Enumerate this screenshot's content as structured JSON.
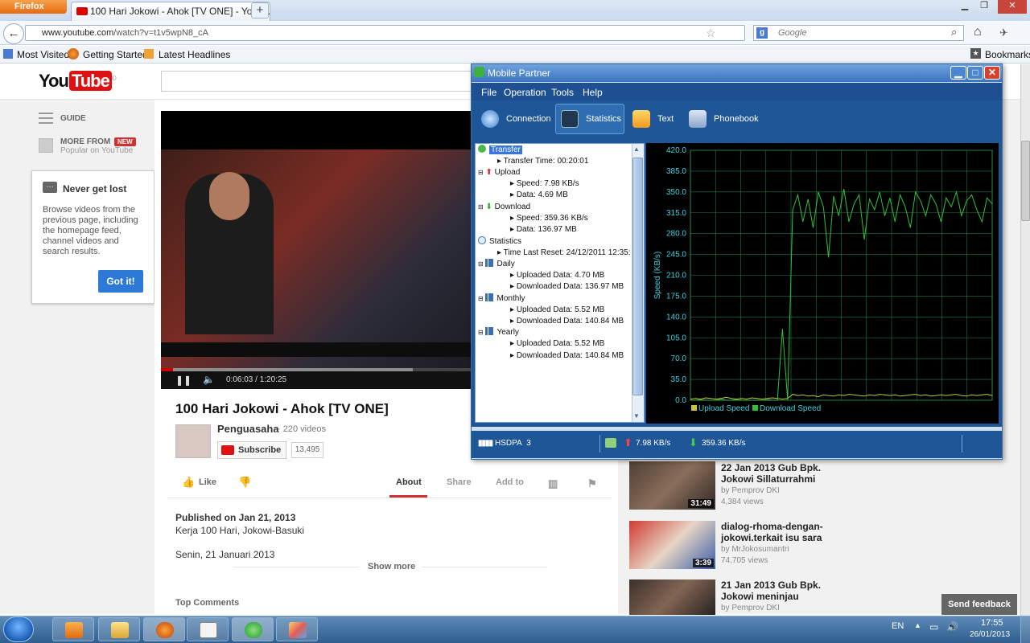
{
  "browser": {
    "menu_button": "Firefox",
    "tab_title": "100 Hari Jokowi - Ahok [TV ONE] - YouT...",
    "tab_close": "✕",
    "new_tab": "+",
    "url_host": "www.youtube.com",
    "url_path": "/watch?v=t1v5wpN8_cA",
    "search_placeholder": "Google",
    "bookmarks": [
      "Most Visited",
      "Getting Started",
      "Latest Headlines"
    ],
    "bookmarks_menu": "Bookmarks"
  },
  "youtube": {
    "logo_you": "You",
    "logo_tube": "Tube",
    "logo_suffix": "ID",
    "guide": "GUIDE",
    "more_from": "MORE FROM",
    "new_badge": "NEW",
    "popular": "Popular on YouTube",
    "popup_title": "Never get lost",
    "popup_text": "Browse videos from the previous page, including the homepage feed, channel videos and search results.",
    "popup_button": "Got it!",
    "video_time": "0:06:03",
    "video_duration": "1:20:25",
    "progress_played_pct": 4,
    "progress_buffered_pct": 81,
    "video_title": "100 Hari Jokowi - Ahok [TV ONE]",
    "channel": "Penguasaha",
    "channel_videos": "220 videos",
    "subscribe": "Subscribe",
    "subscriber_count": "13,495",
    "like": "Like",
    "tabs": [
      "About",
      "Share",
      "Add to"
    ],
    "published": "Published on Jan 21, 2013",
    "desc_line1": "Kerja 100 Hari, Jokowi-Basuki",
    "desc_line2": "Senin, 21 Januari 2013",
    "show_more": "Show more",
    "top_comments": "Top Comments",
    "suggestions": [
      {
        "title": "22 Jan 2013 Gub Bpk. Jokowi Sillaturrahmi",
        "by": "by Pemprov DKI",
        "views": "4,384 views",
        "duration": "31:49"
      },
      {
        "title": "dialog-rhoma-dengan-jokowi.terkait isu sara",
        "by": "by MrJokosumantri",
        "views": "74,705 views",
        "duration": "3:39"
      },
      {
        "title": "21 Jan 2013 Gub Bpk. Jokowi meninjau",
        "by": "by Pemprov DKI",
        "views": "",
        "duration": ""
      }
    ],
    "feedback": "Send feedback"
  },
  "mobile_partner": {
    "title": "Mobile Partner",
    "menu": [
      "File",
      "Operation",
      "Tools",
      "Help"
    ],
    "toolbar": [
      "Connection",
      "Statistics",
      "Text",
      "Phonebook"
    ],
    "tree": {
      "transfer": "Transfer",
      "transfer_time": "Transfer Time: 00:20:01",
      "upload": "Upload",
      "up_speed": "Speed: 7.98 KB/s",
      "up_data": "Data: 4.69 MB",
      "download": "Download",
      "down_speed": "Speed: 359.36 KB/s",
      "down_data": "Data: 136.97 MB",
      "statistics": "Statistics",
      "time_last_reset": "Time Last Reset: 24/12/2011 12:35:",
      "daily": "Daily",
      "daily_up": "Uploaded Data: 4.70 MB",
      "daily_down": "Downloaded Data: 136.97 MB",
      "monthly": "Monthly",
      "monthly_up": "Uploaded Data: 5.52 MB",
      "monthly_down": "Downloaded Data: 140.84 MB",
      "yearly": "Yearly",
      "yearly_up": "Uploaded Data: 5.52 MB",
      "yearly_down": "Downloaded Data: 140.84 MB"
    },
    "status": {
      "network": "HSDPA",
      "signal": "3",
      "up_speed": "7.98 KB/s",
      "down_speed": "359.36 KB/s"
    }
  },
  "chart_data": {
    "type": "line",
    "ylabel": "Speed (KB/s)",
    "ylim": [
      0,
      420
    ],
    "yticks": [
      "420.0",
      "385.0",
      "350.0",
      "315.0",
      "280.0",
      "245.0",
      "210.0",
      "175.0",
      "140.0",
      "105.0",
      "70.0",
      "35.0",
      "0.0"
    ],
    "legend": [
      "Upload Speed",
      "Download Speed"
    ],
    "colors": {
      "upload": "#c9c63a",
      "download": "#2fc23a",
      "grid": "#1f7a4a"
    },
    "series": [
      {
        "name": "Upload Speed",
        "values": [
          2,
          3,
          2,
          4,
          3,
          2,
          3,
          5,
          3,
          2,
          3,
          2,
          4,
          3,
          2,
          3,
          4,
          3,
          2,
          3,
          10,
          8,
          9,
          7,
          8,
          6,
          9,
          8,
          7,
          9,
          8,
          10,
          9,
          8,
          7,
          9,
          8,
          10,
          9,
          8,
          9,
          7,
          8,
          9,
          10,
          8,
          9,
          7,
          8,
          9,
          8,
          9,
          10,
          8,
          7,
          9,
          8,
          9,
          10,
          8
        ]
      },
      {
        "name": "Download Speed",
        "values": [
          0,
          0,
          1,
          0,
          0,
          0,
          2,
          0,
          0,
          1,
          0,
          0,
          0,
          0,
          0,
          1,
          0,
          0,
          120,
          0,
          320,
          345,
          300,
          338,
          290,
          350,
          325,
          240,
          343,
          310,
          355,
          300,
          330,
          345,
          270,
          338,
          320,
          350,
          310,
          340,
          300,
          345,
          325,
          290,
          350,
          335,
          310,
          345,
          330,
          300,
          340,
          325,
          350,
          310,
          335,
          345,
          320,
          300,
          340,
          330
        ]
      }
    ]
  },
  "taskbar": {
    "lang": "EN",
    "time": "17:55",
    "date": "26/01/2013"
  }
}
